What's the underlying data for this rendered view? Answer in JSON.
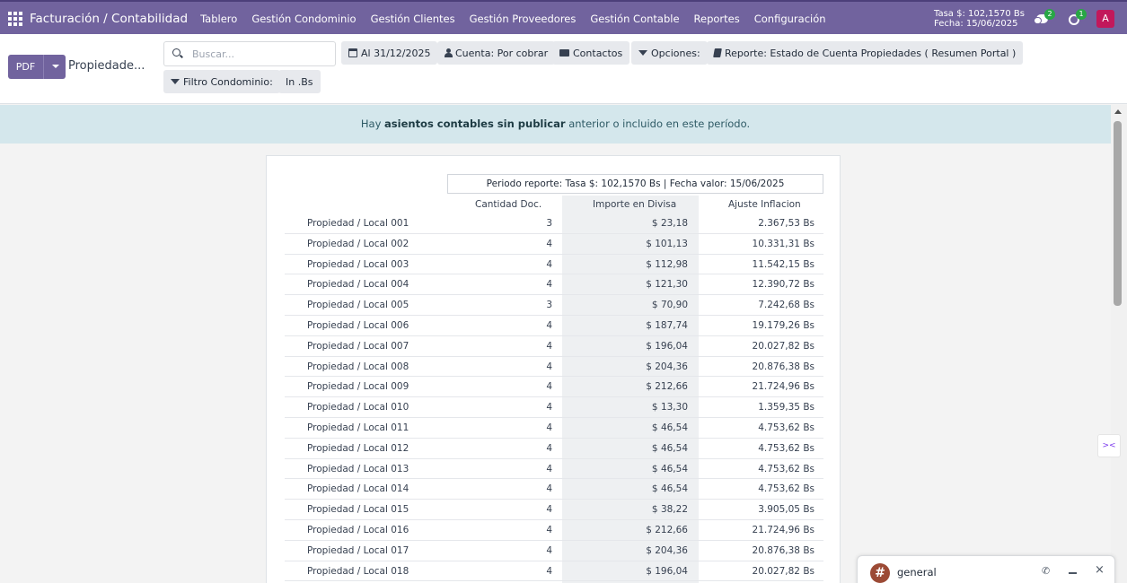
{
  "navbar": {
    "brand": "Facturación / Contabilidad",
    "menu": [
      "Tablero",
      "Gestión Condominio",
      "Gestión Clientes",
      "Gestión Proveedores",
      "Gestión Contable",
      "Reportes",
      "Configuración"
    ],
    "rate_line1": "Tasa $: 102,1570 Bs",
    "rate_line2": "Fecha: 15/06/2025",
    "messages_badge": "2",
    "activities_badge": "1",
    "avatar_letter": "A",
    "accent_color": "#71639e"
  },
  "control": {
    "pdf_label": "PDF",
    "breadcrumb": "Propiedade...",
    "search_placeholder": "Buscar...",
    "filters": {
      "date": "Al 31/12/2025",
      "account": "Cuenta: Por cobrar",
      "contacts": "Contactos",
      "options": "Opciones:",
      "report": "Reporte: Estado de Cuenta Propiedades ( Resumen Portal )",
      "condo": "Filtro Condominio:",
      "currency": "In .Bs"
    }
  },
  "alert": {
    "prefix": "Hay ",
    "bold": "asientos contables sin publicar",
    "suffix": " anterior o incluido en este período."
  },
  "report": {
    "period": "Periodo reporte: Tasa $: 102,1570 Bs | Fecha valor: 15/06/2025",
    "headers": [
      "Cantidad Doc.",
      "Importe en Divisa",
      "Ajuste Inflacion"
    ],
    "rows": [
      {
        "name": "Propiedad / Local 001",
        "qty": "3",
        "usd": "$ 23,18",
        "bs": "2.367,53 Bs"
      },
      {
        "name": "Propiedad / Local 002",
        "qty": "4",
        "usd": "$ 101,13",
        "bs": "10.331,31 Bs"
      },
      {
        "name": "Propiedad / Local 003",
        "qty": "4",
        "usd": "$ 112,98",
        "bs": "11.542,15 Bs"
      },
      {
        "name": "Propiedad / Local 004",
        "qty": "4",
        "usd": "$ 121,30",
        "bs": "12.390,72 Bs"
      },
      {
        "name": "Propiedad / Local 005",
        "qty": "3",
        "usd": "$ 70,90",
        "bs": "7.242,68 Bs"
      },
      {
        "name": "Propiedad / Local 006",
        "qty": "4",
        "usd": "$ 187,74",
        "bs": "19.179,26 Bs"
      },
      {
        "name": "Propiedad / Local 007",
        "qty": "4",
        "usd": "$ 196,04",
        "bs": "20.027,82 Bs"
      },
      {
        "name": "Propiedad / Local 008",
        "qty": "4",
        "usd": "$ 204,36",
        "bs": "20.876,38 Bs"
      },
      {
        "name": "Propiedad / Local 009",
        "qty": "4",
        "usd": "$ 212,66",
        "bs": "21.724,96 Bs"
      },
      {
        "name": "Propiedad / Local 010",
        "qty": "4",
        "usd": "$ 13,30",
        "bs": "1.359,35 Bs"
      },
      {
        "name": "Propiedad / Local 011",
        "qty": "4",
        "usd": "$ 46,54",
        "bs": "4.753,62 Bs"
      },
      {
        "name": "Propiedad / Local 012",
        "qty": "4",
        "usd": "$ 46,54",
        "bs": "4.753,62 Bs"
      },
      {
        "name": "Propiedad / Local 013",
        "qty": "4",
        "usd": "$ 46,54",
        "bs": "4.753,62 Bs"
      },
      {
        "name": "Propiedad / Local 014",
        "qty": "4",
        "usd": "$ 46,54",
        "bs": "4.753,62 Bs"
      },
      {
        "name": "Propiedad / Local 015",
        "qty": "4",
        "usd": "$ 38,22",
        "bs": "3.905,05 Bs"
      },
      {
        "name": "Propiedad / Local 016",
        "qty": "4",
        "usd": "$ 212,66",
        "bs": "21.724,96 Bs"
      },
      {
        "name": "Propiedad / Local 017",
        "qty": "4",
        "usd": "$ 204,36",
        "bs": "20.876,38 Bs"
      },
      {
        "name": "Propiedad / Local 018",
        "qty": "4",
        "usd": "$ 196,04",
        "bs": "20.027,82 Bs"
      }
    ]
  },
  "chat": {
    "channel": "general",
    "close_symbol": "×"
  }
}
